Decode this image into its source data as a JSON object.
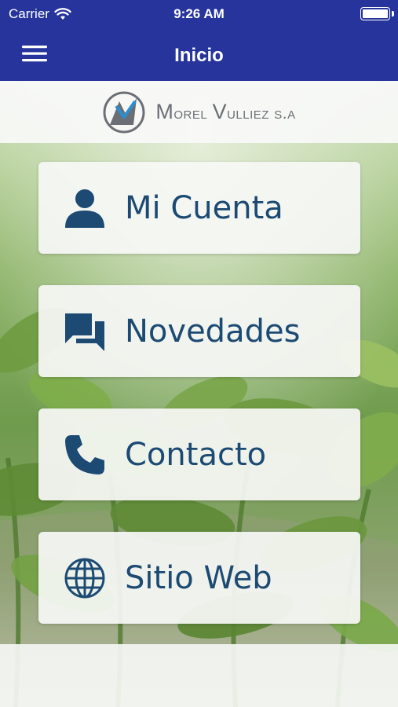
{
  "status_bar": {
    "carrier": "Carrier",
    "time": "9:26 AM",
    "wifi_icon": "wifi-icon",
    "battery_icon": "battery-icon"
  },
  "nav": {
    "title": "Inicio",
    "menu_icon": "hamburger-menu-icon"
  },
  "brand": {
    "logo_icon": "morel-vulliez-logo",
    "name_first_letter_1": "M",
    "name_rest_1": "orel ",
    "name_first_letter_2": "V",
    "name_rest_2": "ulliez s.a"
  },
  "menu": {
    "items": [
      {
        "label": "Mi Cuenta",
        "icon": "user-icon"
      },
      {
        "label": "Novedades",
        "icon": "chat-bubbles-icon"
      },
      {
        "label": "Contacto",
        "icon": "phone-icon"
      },
      {
        "label": "Sitio Web",
        "icon": "globe-icon"
      }
    ]
  },
  "colors": {
    "header": "#26349b",
    "label_text": "#1c4a73",
    "brand_text": "#6b6e74"
  }
}
